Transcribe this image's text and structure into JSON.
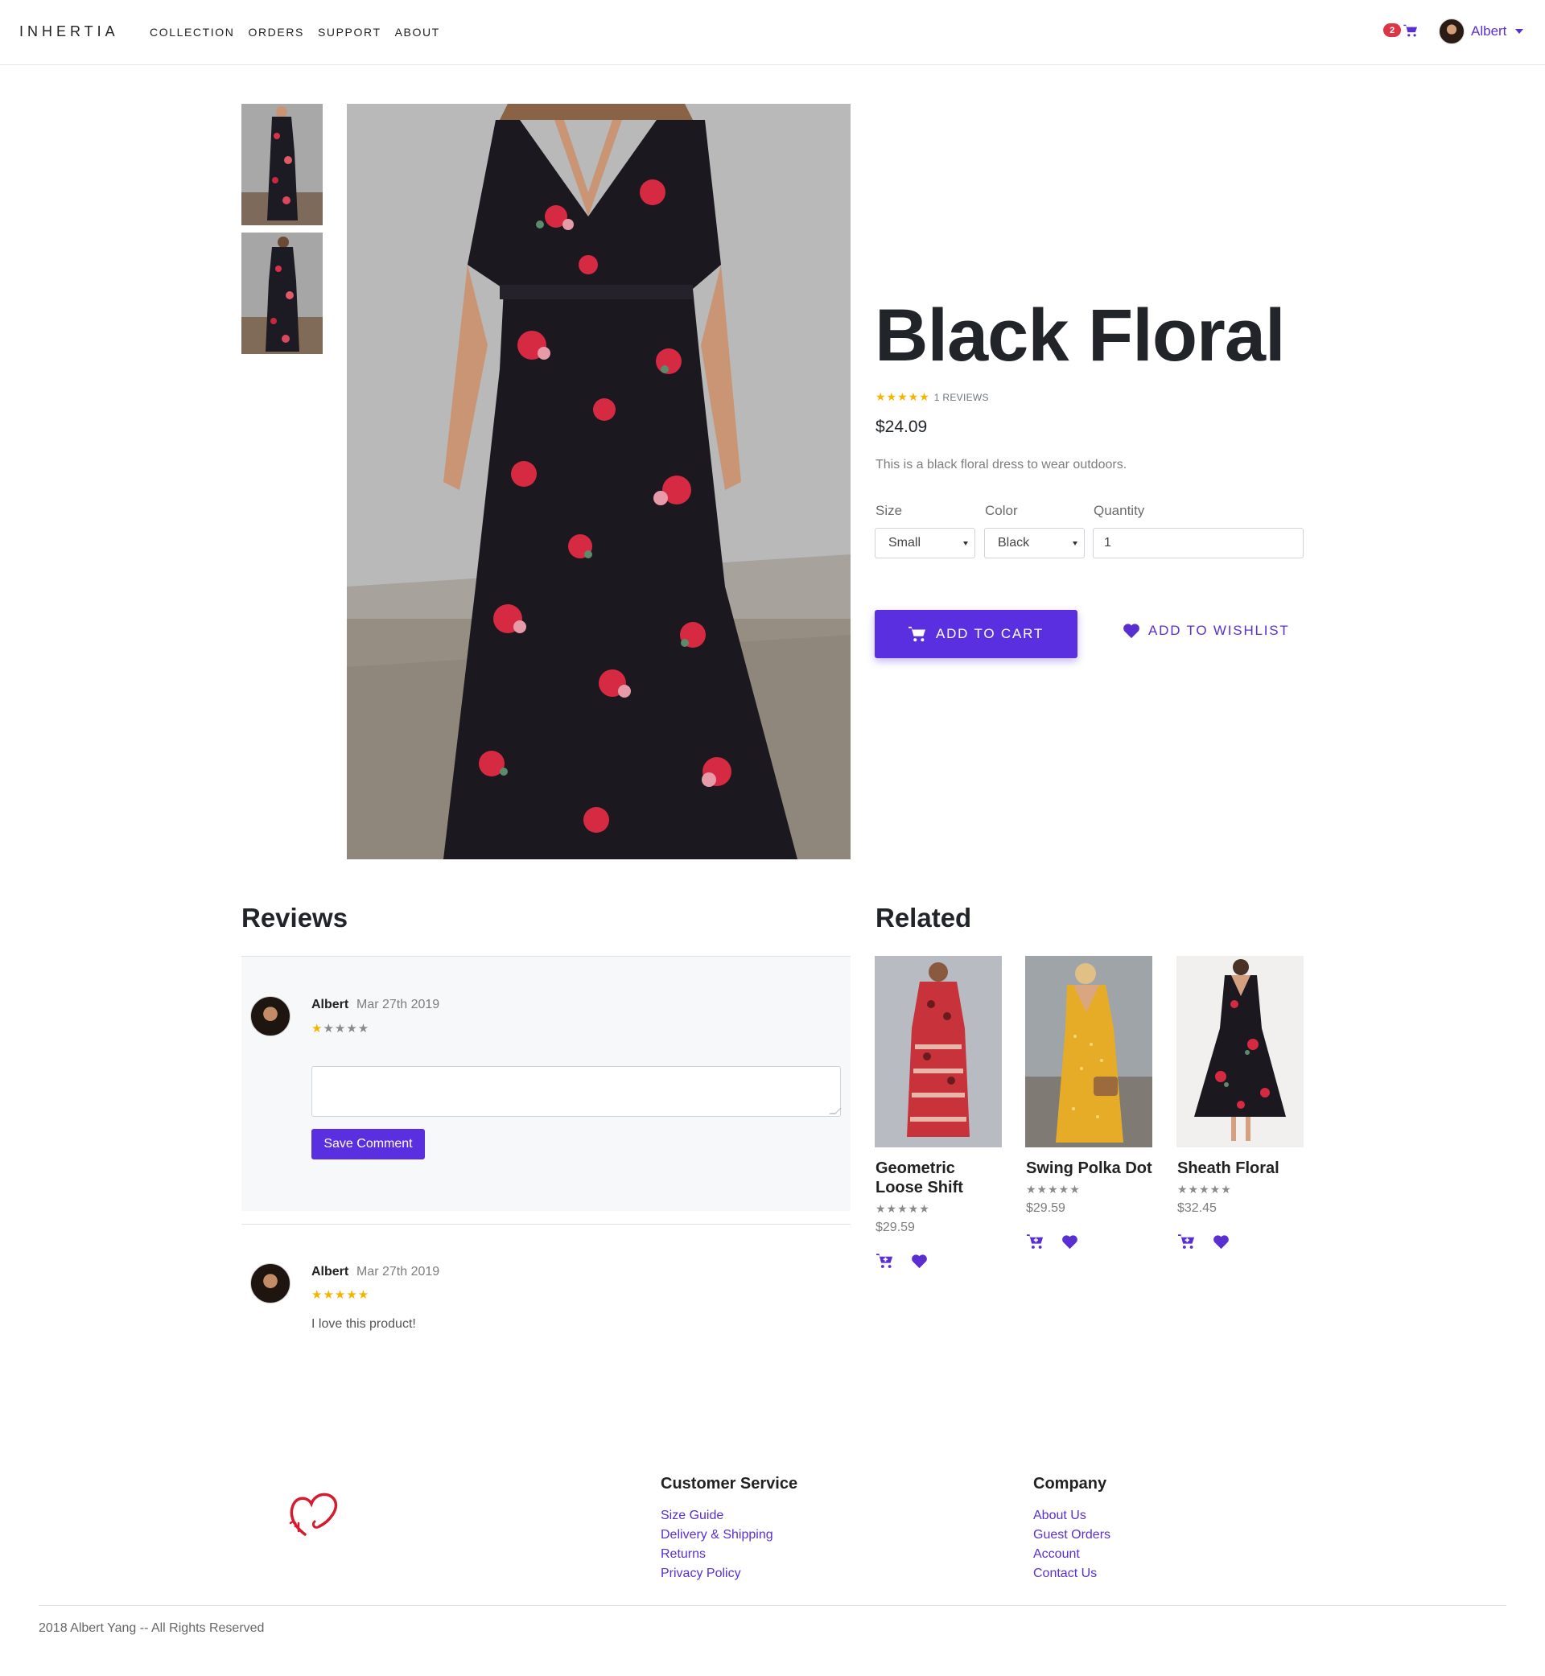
{
  "nav": {
    "brand": "INHERTIA",
    "links": [
      "COLLECTION",
      "ORDERS",
      "SUPPORT",
      "ABOUT"
    ],
    "cart_count": "2",
    "user_name": "Albert",
    "cart_icon": "cart-icon",
    "accent": "#5a2fd1",
    "badge_color": "#dc3545"
  },
  "product": {
    "title": "Black Floral",
    "stars": "★★★★★",
    "reviews_label": "1 REVIEWS",
    "price": "$24.09",
    "description": "This is a black floral dress to wear outdoors.",
    "size_label": "Size",
    "size_value": "Small",
    "color_label": "Color",
    "color_value": "Black",
    "quantity_label": "Quantity",
    "quantity_value": "1",
    "add_to_cart": "ADD TO CART",
    "add_to_wishlist": "ADD TO WISHLIST",
    "button_color": "#5a2fe0"
  },
  "reviews": {
    "heading": "Reviews",
    "items": [
      {
        "name": "Albert",
        "date": "Mar 27th 2019",
        "stars_on": "★",
        "stars_off": "★★★★",
        "rating": 1,
        "comment_placeholder": "",
        "save_label": "Save Comment"
      },
      {
        "name": "Albert",
        "date": "Mar 27th 2019",
        "stars_on": "★★★★★",
        "rating": 5,
        "text": "I love this product!"
      }
    ]
  },
  "related": {
    "heading": "Related",
    "items": [
      {
        "name": "Geometric Loose Shift",
        "stars": "★★★★★",
        "price": "$29.59"
      },
      {
        "name": "Swing Polka Dot",
        "stars": "★★★★★",
        "price": "$29.59"
      },
      {
        "name": "Sheath Floral",
        "stars": "★★★★★",
        "price": "$32.45"
      }
    ]
  },
  "footer": {
    "customer_service": {
      "heading": "Customer Service",
      "links": [
        "Size Guide",
        "Delivery & Shipping",
        "Returns",
        "Privacy Policy"
      ]
    },
    "company": {
      "heading": "Company",
      "links": [
        "About Us",
        "Guest Orders",
        "Account",
        "Contact Us"
      ]
    },
    "copyright": "2018 Albert Yang -- All Rights Reserved",
    "logo_icon": "heart-logo-icon"
  }
}
